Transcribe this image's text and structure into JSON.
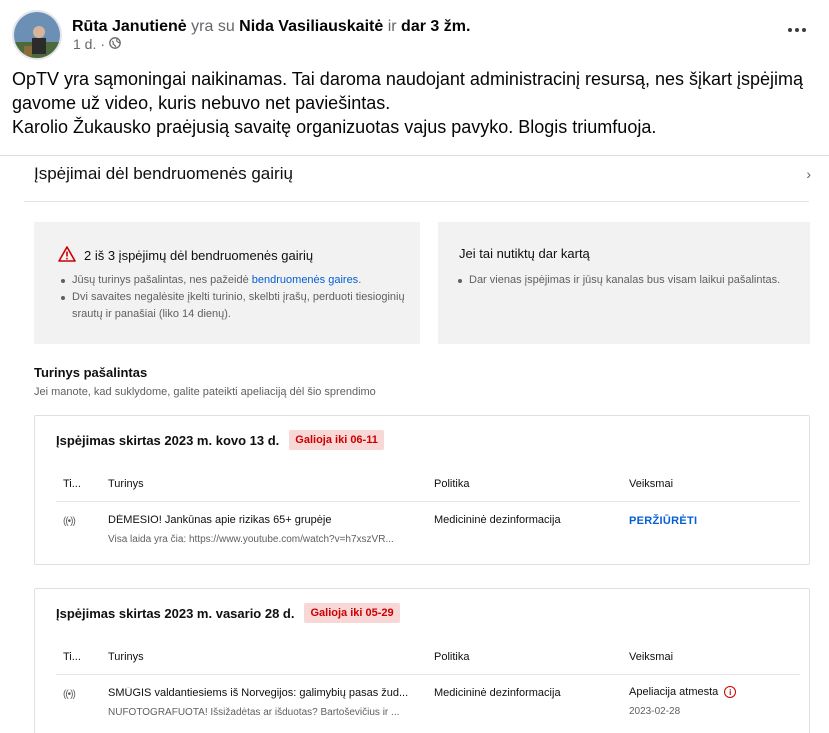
{
  "post": {
    "author": "Rūta Janutienė",
    "with_word": "yra su",
    "tagged": "Nida Vasiliauskaitė",
    "and_word": "ir",
    "others": "dar 3 žm.",
    "time": "1 d.",
    "audience_icon": "globe-icon",
    "more_icon": "more-dots-icon",
    "text_lines": [
      "OpTV yra sąmoningai naikinamas. Tai daroma naudojant administracinį resursą, nes šįkart įspėjimą",
      "gavome už video, kuris nebuvo net paviešintas.",
      "Karolio Žukausko praėjusią savaitę organizuotas vajus pavyko. Blogis triumfuoja."
    ]
  },
  "yt": {
    "title": "Įspėjimai dėl bendruomenės gairių",
    "left_panel": {
      "heading": "2 iš 3 įspėjimų dėl bendruomenės gairių",
      "item1_prefix": "Jūsų turinys pašalintas, nes pažeidė ",
      "item1_link": "bendruomenės gaires",
      "item1_suffix": ".",
      "item2": "Dvi savaites negalėsite įkelti turinio, skelbti įrašų, perduoti tiesioginių srautų ir panašiai (liko 14 dienų)."
    },
    "right_panel": {
      "heading": "Jei tai nutiktų dar kartą",
      "item1": "Dar vienas įspėjimas ir jūsų kanalas bus visam laikui pašalintas."
    },
    "removed_title": "Turinys pašalintas",
    "removed_sub": "Jei manote, kad suklydome, galite pateikti apeliaciją dėl šio sprendimo",
    "columns": {
      "type": "Ti...",
      "content": "Turinys",
      "policy": "Politika",
      "actions": "Veiksmai"
    },
    "strikes": [
      {
        "title": "Įspėjimas skirtas 2023 m. kovo 13 d.",
        "badge": "Galioja iki 06-11",
        "type_glyph": "((•))",
        "video_title": "DĖMESIO! Jankūnas apie rizikas 65+ grupėje",
        "video_desc": "Visa laida yra čia: https://www.youtube.com/watch?v=h7xszVR...",
        "policy": "Medicininė dezinformacija",
        "action_link": "PERŽIŪRĖTI"
      },
      {
        "title": "Įspėjimas skirtas 2023 m. vasario 28 d.",
        "badge": "Galioja iki 05-29",
        "type_glyph": "((•))",
        "video_title": "SMŪGIS valdantiesiems iš Norvegijos: galimybių pasas žud...",
        "video_desc": "NUFOTOGRAFUOTA! Išsižadėtas ar išduotas? Bartoševičius ir ...",
        "policy": "Medicininė dezinformacija",
        "action_text": "Apeliacija atmesta",
        "action_date": "2023-02-28"
      }
    ]
  }
}
